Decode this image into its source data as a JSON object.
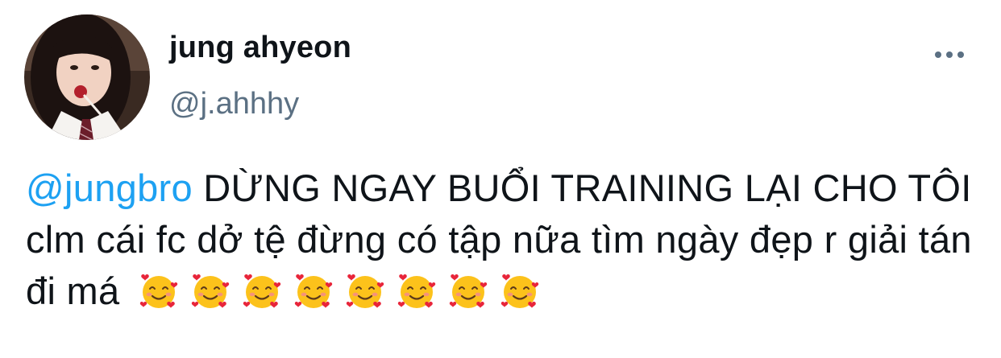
{
  "author": {
    "display_name": "jung ahyeon",
    "handle": "@j.ahhhy"
  },
  "tweet": {
    "mention": "@jungbro",
    "text": "DỪNG NGAY BUỔI TRAINING LẠI CHO TÔI clm cái fc dở tệ đừng có tập nữa tìm ngày đẹp r giải tán đi má",
    "emoji": "smiling-face-with-hearts",
    "emoji_count": 8
  },
  "icons": {
    "more": "more-horizontal-icon"
  },
  "colors": {
    "mention": "#1da1f2",
    "secondary_text": "#5b7083",
    "primary_text": "#0f1419"
  }
}
